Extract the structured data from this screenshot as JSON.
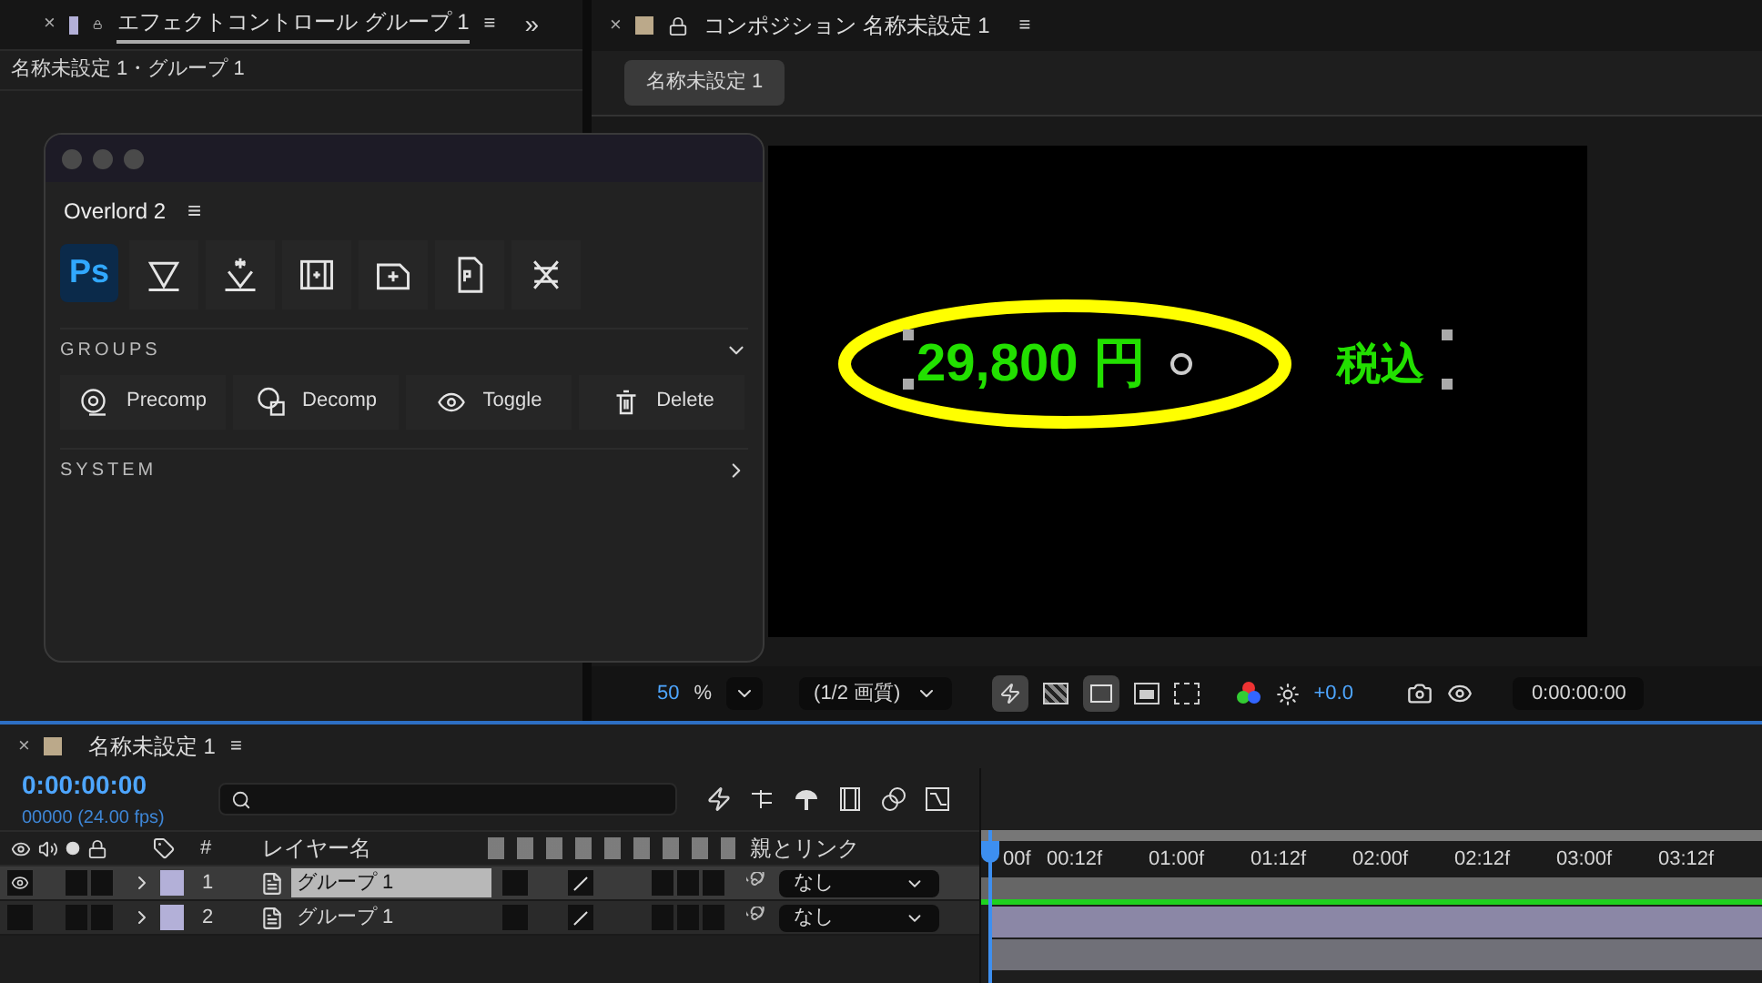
{
  "effect_panel": {
    "close": "×",
    "title": "エフェクトコントロール グループ 1",
    "menu": "≡",
    "more": "»",
    "breadcrumb": "名称未設定 1・グループ 1"
  },
  "overlord": {
    "title": "Overlord 2",
    "menu": "≡",
    "tools": [
      {
        "kind": "ps",
        "label": "Ps"
      },
      {
        "kind": "triangle"
      },
      {
        "kind": "burst"
      },
      {
        "kind": "film"
      },
      {
        "kind": "add"
      },
      {
        "kind": "psfile"
      },
      {
        "kind": "cross"
      }
    ],
    "sections": [
      {
        "title": "GROUPS",
        "expanded": true,
        "buttons": [
          {
            "kind": "precomp",
            "label": "Precomp"
          },
          {
            "kind": "decomp",
            "label": "Decomp"
          },
          {
            "kind": "toggle",
            "label": "Toggle"
          },
          {
            "kind": "delete",
            "label": "Delete"
          }
        ]
      },
      {
        "title": "SYSTEM",
        "expanded": false
      }
    ]
  },
  "composition": {
    "close": "×",
    "title": "コンポジション 名称未設定 1",
    "menu": "≡",
    "tab": "名称未設定 1",
    "price": "29,800 円",
    "tax": "税込",
    "toolbar": {
      "zoom": "50",
      "percent": "%",
      "resolution": "(1/2 画質)",
      "exposure": "+0.0",
      "timecode": "0:00:00:00"
    }
  },
  "timeline": {
    "close": "×",
    "title": "名称未設定 1",
    "menu": "≡",
    "timecode": "0:00:00:00",
    "fps": "00000 (24.00 fps)",
    "columns": {
      "number": "#",
      "layer_name": "レイヤー名",
      "parent": "親とリンク"
    },
    "layers": [
      {
        "number": "1",
        "name": "グループ 1",
        "selected": true,
        "visible": true,
        "parent": "なし"
      },
      {
        "number": "2",
        "name": "グループ 1",
        "selected": false,
        "visible": false,
        "parent": "なし"
      }
    ],
    "ruler": [
      "00f",
      "00:12f",
      "01:00f",
      "01:12f",
      "02:00f",
      "02:12f",
      "03:00f",
      "03:12f"
    ]
  }
}
